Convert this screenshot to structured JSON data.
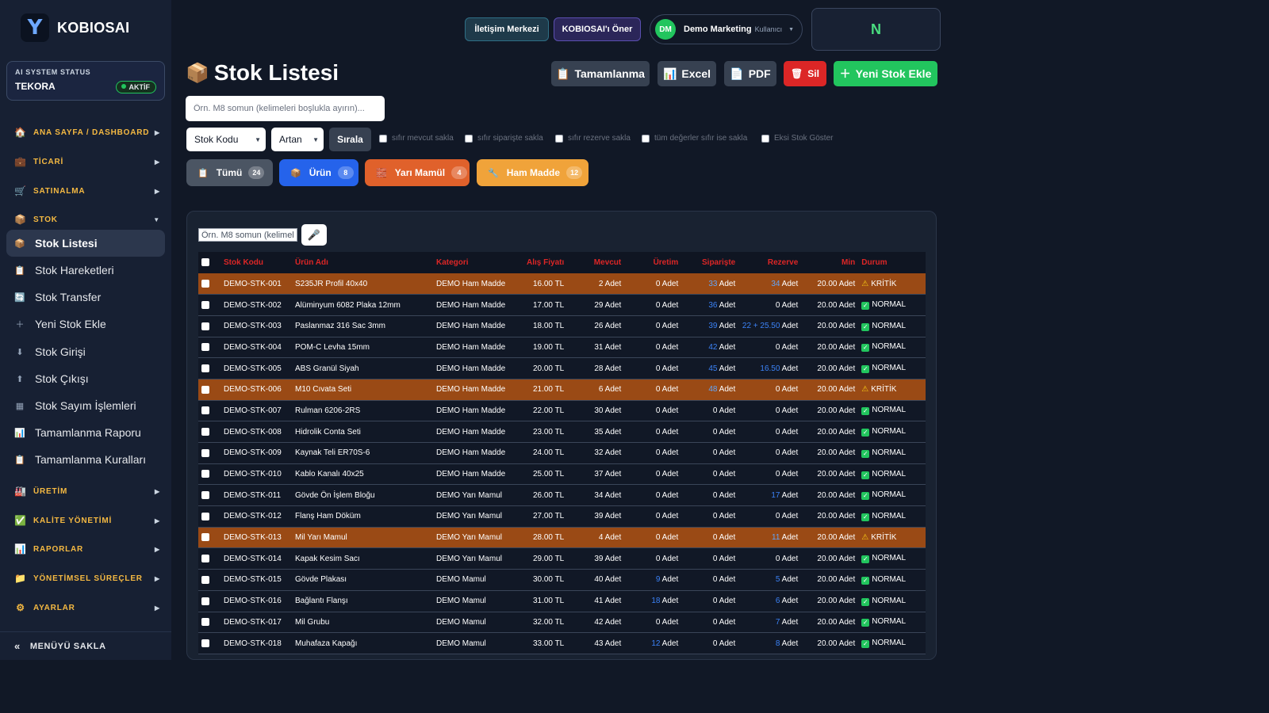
{
  "brand": {
    "logo_letter": "Y",
    "name": "KOBIOSAI"
  },
  "ai_status": {
    "label": "AI SYSTEM STATUS",
    "name": "TEKORA",
    "badge": "AKTİF"
  },
  "sidebar": {
    "sections": {
      "dashboard": "ANA SAYFA / DASHBOARD",
      "ticari": "TİCARİ",
      "satinalma": "SATINALMA",
      "stok": "STOK",
      "uretim": "ÜRETİM",
      "kalite": "KALİTE YÖNETİMİ",
      "raporlar": "RAPORLAR",
      "yonetimsel": "YÖNETİMSEL SÜREÇLER",
      "ayarlar": "AYARLAR"
    },
    "stok_items": [
      "Stok Listesi",
      "Stok Hareketleri",
      "Stok Transfer",
      "Yeni Stok Ekle",
      "Stok Girişi",
      "Stok Çıkışı",
      "Stok Sayım İşlemleri",
      "Tamamlanma Raporu",
      "Tamamlanma Kuralları"
    ],
    "collapse": "MENÜYÜ SAKLA"
  },
  "topbar": {
    "contact": "İletişim Merkezi",
    "suggest": "KOBIOSAI'ı Öner",
    "user_initials": "DM",
    "user_name": "Demo Marketing",
    "user_role": "Kullanıcı",
    "n_label": "N"
  },
  "page": {
    "title": "Stok Listesi",
    "actions": {
      "tamamlanma": "Tamamlanma",
      "excel": "Excel",
      "pdf": "PDF",
      "sil": "Sil",
      "yeni": "Yeni Stok Ekle"
    },
    "search_placeholder": "Örn. M8 somun (kelimeleri boşlukla ayırın)...",
    "sort_field": "Stok Kodu",
    "sort_dir": "Artan",
    "sort_button": "Sırala",
    "options": [
      "sıfır mevcut sakla",
      "sıfır siparişte sakla",
      "sıfır rezerve sakla",
      "tüm değerler sıfır ise sakla",
      "Eksi Stok Göster"
    ],
    "filters": {
      "all": {
        "label": "Tümü",
        "count": "24"
      },
      "urun": {
        "label": "Ürün",
        "count": "8"
      },
      "yari": {
        "label": "Yarı Mamül",
        "count": "4"
      },
      "ham": {
        "label": "Ham Madde",
        "count": "12"
      }
    },
    "table_search_placeholder": "Örn. M8 somun (kelimeleri boşlukla ayırın)..."
  },
  "table": {
    "headers": [
      "Stok Kodu",
      "Ürün Adı",
      "Kategori",
      "Alış Fiyatı",
      "Mevcut",
      "Üretim",
      "Siparişte",
      "Rezerve",
      "Min",
      "Durum"
    ],
    "rows": [
      {
        "code": "DEMO-STK-001",
        "name": "S235JR Profil 40x40",
        "cat": "DEMO Ham Madde",
        "price": "16.00 TL",
        "stock": "2",
        "prod": "0",
        "order": "33",
        "reserve": "34",
        "min": "20.00 Adet",
        "status": "KRİTİK",
        "critical": true
      },
      {
        "code": "DEMO-STK-002",
        "name": "Alüminyum 6082 Plaka 12mm",
        "cat": "DEMO Ham Madde",
        "price": "17.00 TL",
        "stock": "29",
        "prod": "0",
        "order": "36",
        "reserve": "0",
        "min": "20.00 Adet",
        "status": "NORMAL",
        "critical": false
      },
      {
        "code": "DEMO-STK-003",
        "name": "Paslanmaz 316 Sac 3mm",
        "cat": "DEMO Ham Madde",
        "price": "18.00 TL",
        "stock": "26",
        "prod": "0",
        "order": "39",
        "reserve": "22 + 25.50",
        "min": "20.00 Adet",
        "status": "NORMAL",
        "critical": false
      },
      {
        "code": "DEMO-STK-004",
        "name": "POM-C Levha 15mm",
        "cat": "DEMO Ham Madde",
        "price": "19.00 TL",
        "stock": "31",
        "prod": "0",
        "order": "42",
        "reserve": "0",
        "min": "20.00 Adet",
        "status": "NORMAL",
        "critical": false
      },
      {
        "code": "DEMO-STK-005",
        "name": "ABS Granül Siyah",
        "cat": "DEMO Ham Madde",
        "price": "20.00 TL",
        "stock": "28",
        "prod": "0",
        "order": "45",
        "reserve": "16.50",
        "min": "20.00 Adet",
        "status": "NORMAL",
        "critical": false
      },
      {
        "code": "DEMO-STK-006",
        "name": "M10 Cıvata Seti",
        "cat": "DEMO Ham Madde",
        "price": "21.00 TL",
        "stock": "6",
        "prod": "0",
        "order": "48",
        "reserve": "0",
        "min": "20.00 Adet",
        "status": "KRİTİK",
        "critical": true
      },
      {
        "code": "DEMO-STK-007",
        "name": "Rulman 6206-2RS",
        "cat": "DEMO Ham Madde",
        "price": "22.00 TL",
        "stock": "30",
        "prod": "0",
        "order": "0",
        "reserve": "0",
        "min": "20.00 Adet",
        "status": "NORMAL",
        "critical": false
      },
      {
        "code": "DEMO-STK-008",
        "name": "Hidrolik Conta Seti",
        "cat": "DEMO Ham Madde",
        "price": "23.00 TL",
        "stock": "35",
        "prod": "0",
        "order": "0",
        "reserve": "0",
        "min": "20.00 Adet",
        "status": "NORMAL",
        "critical": false
      },
      {
        "code": "DEMO-STK-009",
        "name": "Kaynak Teli ER70S-6",
        "cat": "DEMO Ham Madde",
        "price": "24.00 TL",
        "stock": "32",
        "prod": "0",
        "order": "0",
        "reserve": "0",
        "min": "20.00 Adet",
        "status": "NORMAL",
        "critical": false
      },
      {
        "code": "DEMO-STK-010",
        "name": "Kablo Kanalı 40x25",
        "cat": "DEMO Ham Madde",
        "price": "25.00 TL",
        "stock": "37",
        "prod": "0",
        "order": "0",
        "reserve": "0",
        "min": "20.00 Adet",
        "status": "NORMAL",
        "critical": false
      },
      {
        "code": "DEMO-STK-011",
        "name": "Gövde Ön İşlem Bloğu",
        "cat": "DEMO Yarı Mamul",
        "price": "26.00 TL",
        "stock": "34",
        "prod": "0",
        "order": "0",
        "reserve": "17",
        "min": "20.00 Adet",
        "status": "NORMAL",
        "critical": false
      },
      {
        "code": "DEMO-STK-012",
        "name": "Flanş Ham Döküm",
        "cat": "DEMO Yarı Mamul",
        "price": "27.00 TL",
        "stock": "39",
        "prod": "0",
        "order": "0",
        "reserve": "0",
        "min": "20.00 Adet",
        "status": "NORMAL",
        "critical": false
      },
      {
        "code": "DEMO-STK-013",
        "name": "Mil Yarı Mamul",
        "cat": "DEMO Yarı Mamul",
        "price": "28.00 TL",
        "stock": "4",
        "prod": "0",
        "order": "0",
        "reserve": "11",
        "min": "20.00 Adet",
        "status": "KRİTİK",
        "critical": true
      },
      {
        "code": "DEMO-STK-014",
        "name": "Kapak Kesim Sacı",
        "cat": "DEMO Yarı Mamul",
        "price": "29.00 TL",
        "stock": "39",
        "prod": "0",
        "order": "0",
        "reserve": "0",
        "min": "20.00 Adet",
        "status": "NORMAL",
        "critical": false
      },
      {
        "code": "DEMO-STK-015",
        "name": "Gövde Plakası",
        "cat": "DEMO Mamul",
        "price": "30.00 TL",
        "stock": "40",
        "prod": "9",
        "order": "0",
        "reserve": "5",
        "min": "20.00 Adet",
        "status": "NORMAL",
        "critical": false
      },
      {
        "code": "DEMO-STK-016",
        "name": "Bağlantı Flanşı",
        "cat": "DEMO Mamul",
        "price": "31.00 TL",
        "stock": "41",
        "prod": "18",
        "order": "0",
        "reserve": "6",
        "min": "20.00 Adet",
        "status": "NORMAL",
        "critical": false
      },
      {
        "code": "DEMO-STK-017",
        "name": "Mil Grubu",
        "cat": "DEMO Mamul",
        "price": "32.00 TL",
        "stock": "42",
        "prod": "0",
        "order": "0",
        "reserve": "7",
        "min": "20.00 Adet",
        "status": "NORMAL",
        "critical": false
      },
      {
        "code": "DEMO-STK-018",
        "name": "Muhafaza Kapağı",
        "cat": "DEMO Mamul",
        "price": "33.00 TL",
        "stock": "43",
        "prod": "12",
        "order": "0",
        "reserve": "8",
        "min": "20.00 Adet",
        "status": "NORMAL",
        "critical": false
      }
    ],
    "unit": "Adet"
  },
  "colors": {
    "critical_row": "#9a4a15",
    "accent_green": "#22c55e",
    "header_red": "#dc2626",
    "highlight_blue": "#3b82f6"
  }
}
